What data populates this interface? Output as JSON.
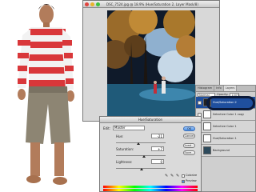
{
  "document": {
    "title": "DSC_7524.jpg @ 18.9% (Hue/Saturation 2, Layer Mask/8)"
  },
  "layers_panel": {
    "tabs": [
      "Histogram",
      "Info",
      "Layers"
    ],
    "blend_mode": "Normal",
    "opacity_label": "Opacity:",
    "opacity_value": "100%",
    "layers": [
      {
        "name": "Hue/Saturation 2",
        "selected": true
      },
      {
        "name": "Selective Color 1 copy",
        "selected": false
      },
      {
        "name": "Selective Color 1",
        "selected": false
      },
      {
        "name": "Hue/Saturation 1",
        "selected": false
      },
      {
        "name": "Background",
        "selected": false
      }
    ]
  },
  "hue_saturation": {
    "title": "Hue/Saturation",
    "edit_label": "Edit:",
    "edit_value": "Master",
    "hue_label": "Hue:",
    "hue_value": "-21",
    "saturation_label": "Saturation:",
    "saturation_value": "+7",
    "lightness_label": "Lightness:",
    "lightness_value": "0",
    "ok_label": "OK",
    "cancel_label": "Cancel",
    "load_label": "Load...",
    "save_label": "Save...",
    "colorize_label": "Colorize",
    "preview_label": "Preview",
    "preview_checked": true,
    "colorize_checked": false
  },
  "colors": {
    "selected_layer": "#1f4f9e",
    "ok_button": "#4b8fe6"
  }
}
